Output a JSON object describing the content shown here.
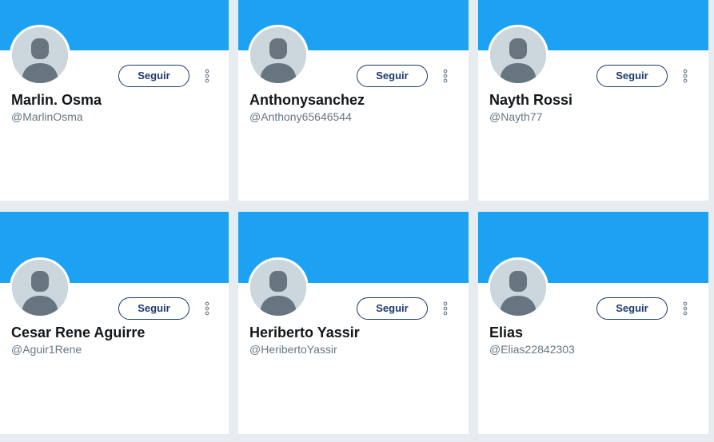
{
  "follow_label": "Seguir",
  "icons": {
    "more": "vertical-ellipsis-icon",
    "avatar": "default-avatar-icon"
  },
  "colors": {
    "banner": "#1da1f2",
    "follow_border": "#1c3a6e",
    "page_background": "#e6ecf0"
  },
  "users": [
    {
      "name": "Marlin. Osma",
      "handle": "@MarlinOsma"
    },
    {
      "name": "Anthonysanchez",
      "handle": "@Anthony65646544"
    },
    {
      "name": "Nayth Rossi",
      "handle": "@Nayth77"
    },
    {
      "name": "Cesar Rene Aguirre",
      "handle": "@Aguir1Rene"
    },
    {
      "name": "Heriberto Yassir",
      "handle": "@HeribertoYassir"
    },
    {
      "name": "Elias",
      "handle": "@Elias22842303"
    }
  ]
}
